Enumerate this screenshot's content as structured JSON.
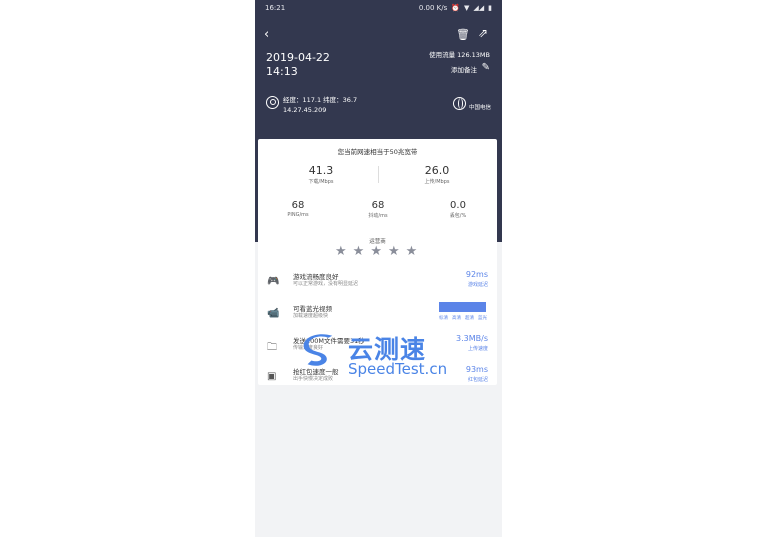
{
  "status_bar": {
    "time": "16:21",
    "speed": "0.00 K/s"
  },
  "header": {
    "date": "2019-04-22",
    "time": "14:13",
    "usage": "使用流量 126.13MB",
    "remark": "添加备注",
    "coords": "经度：117.1  纬度：36.7",
    "ip": "14.27.45.209",
    "isp": "中国电信"
  },
  "card": {
    "bandwidth_title": "您当前网速相当于50兆宽带",
    "download": {
      "value": "41.3",
      "label": "下载/Mbps"
    },
    "upload": {
      "value": "26.0",
      "label": "上传/Mbps"
    },
    "ping": {
      "value": "68",
      "label": "PING/ms"
    },
    "jitter": {
      "value": "68",
      "label": "抖动/ms"
    },
    "loss": {
      "value": "0.0",
      "label": "丢包/%"
    },
    "operator_label": "运营商",
    "stars": [
      "★",
      "★",
      "★",
      "★",
      "★"
    ],
    "rows": [
      {
        "icon": "gamepad-icon",
        "title": "游戏流畅度良好",
        "sub": "可以正常游戏，没有明显延迟",
        "value": "92ms",
        "value_sub": "游戏延迟"
      },
      {
        "icon": "video-icon",
        "title": "可看蓝光视频",
        "sub": "加载速度超级快",
        "quality": [
          "标清",
          "高清",
          "超清",
          "蓝光"
        ]
      },
      {
        "icon": "folder-icon",
        "title": "发送100M文件需要31秒",
        "sub": "传输速度良好",
        "value": "3.3MB/s",
        "value_sub": "上传速度"
      },
      {
        "icon": "redpacket-icon",
        "title": "抢红包速度一般",
        "sub": "出手快慢决定成败",
        "value": "93ms",
        "value_sub": "红包延迟"
      }
    ]
  },
  "watermark": {
    "cn": "云测速",
    "en": "SpeedTest.cn"
  }
}
